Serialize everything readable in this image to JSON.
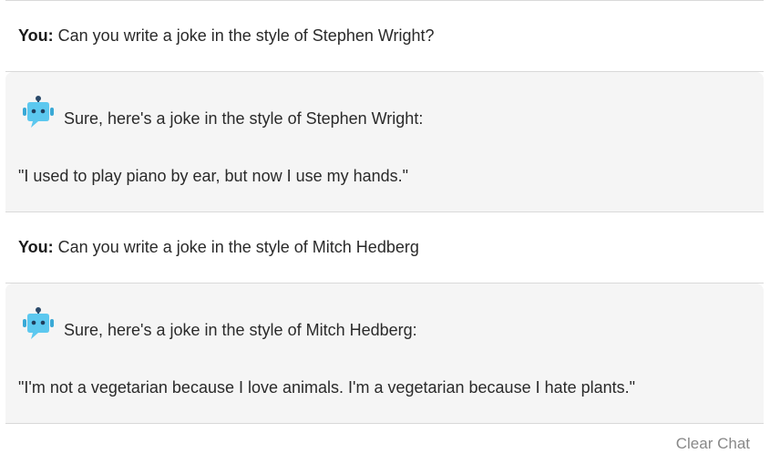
{
  "messages": [
    {
      "role": "user",
      "speaker_label": "You:",
      "text": "Can you write a joke in the style of Stephen Wright?"
    },
    {
      "role": "bot",
      "avatar_icon": "robot-icon",
      "intro": "Sure, here's a joke in the style of Stephen Wright:",
      "joke": "\"I used to play piano by ear, but now I use my hands.\""
    },
    {
      "role": "user",
      "speaker_label": "You:",
      "text": "Can you write a joke in the style of Mitch Hedberg"
    },
    {
      "role": "bot",
      "avatar_icon": "robot-icon",
      "intro": "Sure, here's a joke in the style of Mitch Hedberg:",
      "joke": "\"I'm not a vegetarian because I love animals. I'm a vegetarian because I hate plants.\""
    }
  ],
  "actions": {
    "clear_chat_label": "Clear Chat"
  },
  "colors": {
    "bot_background": "#f5f5f5",
    "divider": "#d9d9d9",
    "robot_blue": "#5cc8ef",
    "clear_chat_text": "#888888"
  }
}
